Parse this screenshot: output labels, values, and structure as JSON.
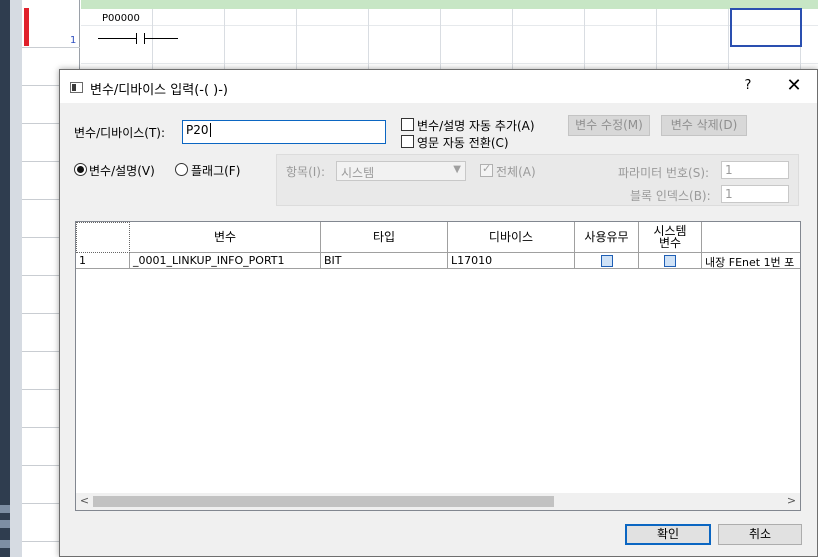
{
  "ladder": {
    "rung_number": "1",
    "contact_label": "P00000"
  },
  "dialog": {
    "title": "변수/디바이스 입력(-( )-)",
    "help": "?",
    "close": "✕",
    "input_label": "변수/디바이스(T):",
    "input_value": "P20",
    "chk_auto_add": "변수/설명 자동 추가(A)",
    "chk_eng_convert": "영문 자동 전환(C)",
    "btn_modify": "변수 수정(M)",
    "btn_delete": "변수 삭제(D)",
    "radio_var": "변수/설명(V)",
    "radio_flag": "플래그(F)",
    "item_label": "항목(I):",
    "item_value": "시스템",
    "chk_all": "전체(A)",
    "param_label": "파라미터 번호(S):",
    "param_value": "1",
    "block_label": "블록 인덱스(B):",
    "block_value": "1",
    "ok": "확인",
    "cancel": "취소"
  },
  "grid": {
    "headers": [
      "",
      "변수",
      "타입",
      "디바이스",
      "사용유무",
      "시스템\n변수",
      ""
    ],
    "rows": [
      {
        "no": "1",
        "var": "_0001_LINKUP_INFO_PORT1",
        "type": "BIT",
        "device": "L17010",
        "desc": "내장 FEnet 1번 포"
      }
    ]
  },
  "colors": {
    "accent": "#0b66c2",
    "rung_marker": "#e0202b",
    "ladder_band": "#c7e6c5"
  }
}
